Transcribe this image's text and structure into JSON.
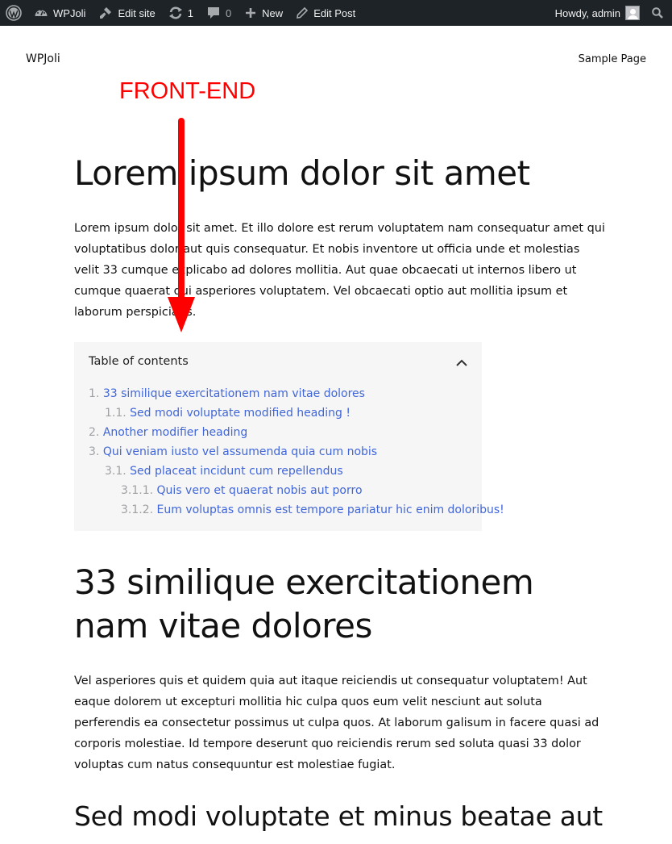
{
  "admin_bar": {
    "wp_logo_icon": "wordpress-logo-icon",
    "site_name": "WPJoli",
    "edit_site": "Edit site",
    "updates_count": "1",
    "comments_count": "0",
    "new_label": "New",
    "edit_post": "Edit Post",
    "howdy": "Howdy, admin",
    "search_icon": "search-icon"
  },
  "site_header": {
    "title": "WPJoli",
    "nav": [
      "Sample Page"
    ]
  },
  "annotation": {
    "label": "FRONT-END",
    "color": "#ff0000"
  },
  "post": {
    "title": "Lorem ipsum dolor sit amet",
    "intro": "Lorem ipsum dolor sit amet. Et illo dolore est rerum voluptatem nam consequatur amet qui voluptatibus dolor aut quis consequatur. Et nobis inventore ut officia unde et molestias velit 33 cumque explicabo ad dolores mollitia. Aut quae obcaecati ut internos libero ut cumque quaerat qui asperiores voluptatem. Vel obcaecati optio aut mollitia ipsum et laborum perspiciatis.",
    "toc": {
      "title": "Table of contents",
      "toggle_icon": "chevron-up-icon",
      "link_color": "#4066d9",
      "items": [
        {
          "num": "1.",
          "label": "33 similique exercitationem nam vitae dolores",
          "level": 1
        },
        {
          "num": "1.1.",
          "label": "Sed modi voluptate modified heading !",
          "level": 2
        },
        {
          "num": "2.",
          "label": "Another modifier heading",
          "level": 1
        },
        {
          "num": "3.",
          "label": "Qui veniam iusto vel assumenda quia cum nobis",
          "level": 1
        },
        {
          "num": "3.1.",
          "label": "Sed placeat incidunt cum repellendus",
          "level": 2
        },
        {
          "num": "3.1.1.",
          "label": "Quis vero et quaerat nobis aut porro",
          "level": 3
        },
        {
          "num": "3.1.2.",
          "label": "Eum voluptas omnis est tempore pariatur hic enim doloribus!",
          "level": 3
        }
      ]
    },
    "section_heading": "33 similique exercitationem nam vitae dolores",
    "section_paragraph": "Vel asperiores quis et quidem quia aut itaque reiciendis ut consequatur voluptatem! Aut eaque dolorem ut excepturi mollitia hic culpa quos eum velit nesciunt aut soluta perferendis ea consectetur possimus ut culpa quos. At laborum galisum in facere quasi ad corporis molestiae. Id tempore deserunt quo reiciendis rerum sed soluta quasi 33 dolor voluptas cum natus consequuntur est molestiae fugiat.",
    "sub_heading": "Sed modi voluptate et minus beatae aut"
  }
}
